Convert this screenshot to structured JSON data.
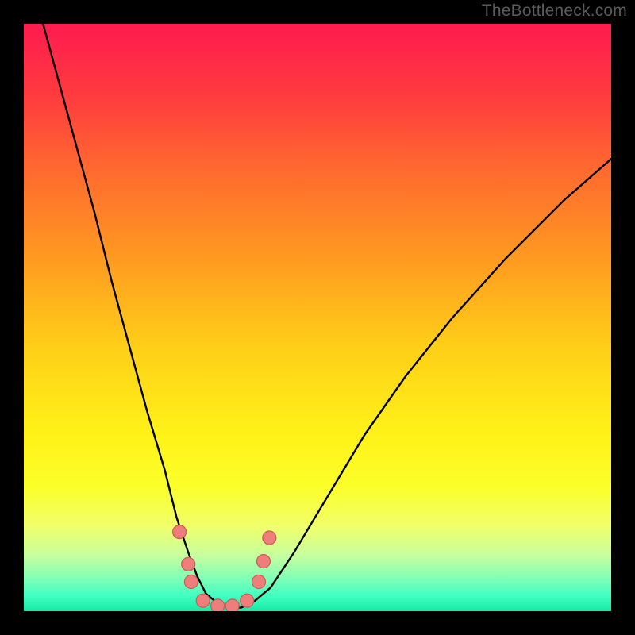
{
  "watermark": "TheBottleneck.com",
  "colors": {
    "bg_black": "#000000",
    "curve": "#000000",
    "dot_fill": "#ed7e7b",
    "dot_stroke": "#cc5b57",
    "gradient_stops": [
      {
        "offset": 0.0,
        "color": "#ff1b4f"
      },
      {
        "offset": 0.12,
        "color": "#ff3a3f"
      },
      {
        "offset": 0.25,
        "color": "#ff6a2f"
      },
      {
        "offset": 0.4,
        "color": "#ff9a20"
      },
      {
        "offset": 0.55,
        "color": "#ffcf18"
      },
      {
        "offset": 0.7,
        "color": "#fff218"
      },
      {
        "offset": 0.79,
        "color": "#fbff2a"
      },
      {
        "offset": 0.855,
        "color": "#f1ff6a"
      },
      {
        "offset": 0.905,
        "color": "#c7ff9e"
      },
      {
        "offset": 0.945,
        "color": "#7effb6"
      },
      {
        "offset": 0.975,
        "color": "#3effc1"
      },
      {
        "offset": 1.0,
        "color": "#18e8a3"
      }
    ]
  },
  "chart_data": {
    "type": "line",
    "title": "",
    "xlabel": "",
    "ylabel": "",
    "xlim": [
      0,
      100
    ],
    "ylim": [
      0,
      100
    ],
    "series": [
      {
        "name": "bottleneck-curve",
        "x": [
          0,
          3,
          6,
          9,
          12,
          15,
          18,
          21,
          24,
          26,
          28,
          29.5,
          31,
          33,
          35,
          37,
          39,
          42,
          46,
          52,
          58,
          65,
          73,
          82,
          92,
          100
        ],
        "y": [
          110,
          101,
          90,
          79,
          68,
          56,
          45,
          34,
          24,
          16,
          10,
          6,
          3,
          1.3,
          0.6,
          0.6,
          1.5,
          4,
          10,
          20,
          30,
          40,
          50,
          60,
          70,
          77
        ]
      }
    ],
    "dots": {
      "name": "highlight-dots",
      "points": [
        {
          "x": 26.5,
          "y": 13.5
        },
        {
          "x": 28.0,
          "y": 8.0
        },
        {
          "x": 28.5,
          "y": 5.0
        },
        {
          "x": 30.5,
          "y": 1.8
        },
        {
          "x": 33.0,
          "y": 0.9
        },
        {
          "x": 35.5,
          "y": 0.9
        },
        {
          "x": 38.0,
          "y": 1.8
        },
        {
          "x": 40.0,
          "y": 5.0
        },
        {
          "x": 40.8,
          "y": 8.5
        },
        {
          "x": 41.8,
          "y": 12.5
        }
      ]
    }
  }
}
